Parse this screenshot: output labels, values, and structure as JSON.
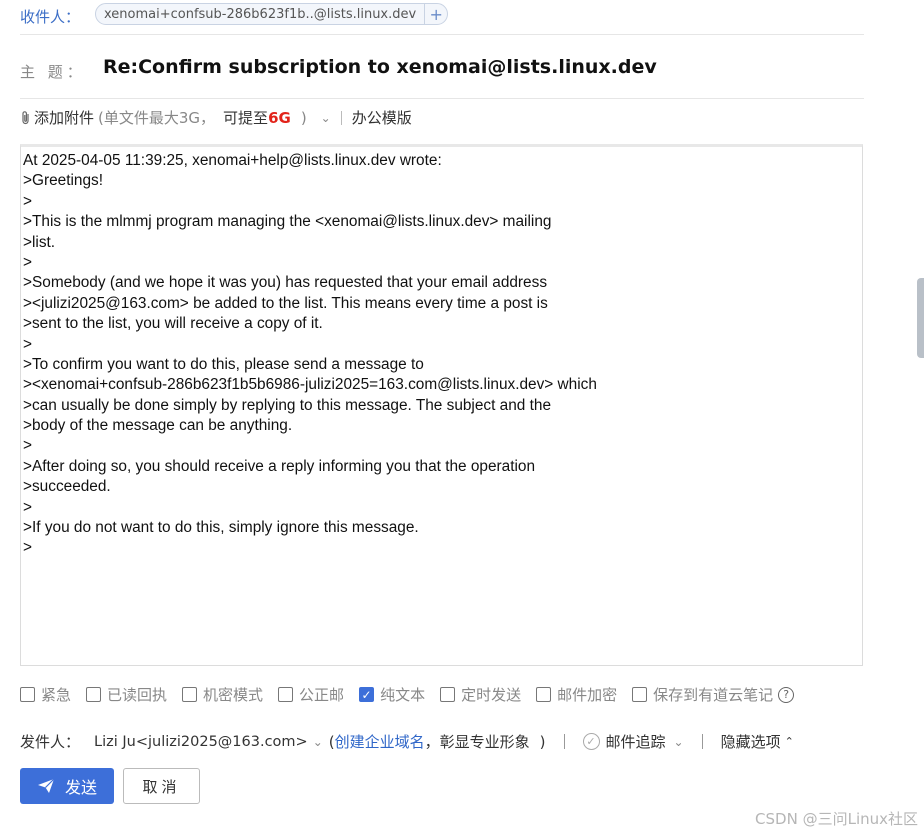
{
  "recipient": {
    "label": "收件人：",
    "address": "xenomai+confsub-286b623f1b..@lists.linux.dev",
    "add_icon": "plus-icon"
  },
  "subject": {
    "label": "主 题：",
    "value": "Re:Confirm subscription to xenomai@lists.linux.dev"
  },
  "attachment": {
    "icon": "paperclip-icon",
    "label": "添加附件",
    "limit_prefix": "(单文件最大3G，",
    "upgrade_text": "可提至",
    "upgrade_size": "6G",
    "limit_suffix": ")",
    "template_label": "办公模版"
  },
  "body_lines": [
    "At 2025-04-05 11:39:25, xenomai+help@lists.linux.dev wrote:",
    ">Greetings!",
    ">",
    ">This is the mlmmj program managing the <xenomai@lists.linux.dev> mailing",
    ">list.",
    ">",
    ">Somebody (and we hope it was you) has requested that your email address",
    "><julizi2025@163.com> be added to the list. This means every time a post is",
    ">sent to the list, you will receive a copy of it.",
    ">",
    ">To confirm you want to do this, please send a message to",
    "><xenomai+confsub-286b623f1b5b6986-julizi2025=163.com@lists.linux.dev> which",
    ">can usually be done simply by replying to this message. The subject and the",
    ">body of the message can be anything.",
    ">",
    ">After doing so, you should receive a reply informing you that the operation",
    ">succeeded.",
    ">",
    ">If you do not want to do this, simply ignore this message.",
    ">"
  ],
  "options": [
    {
      "label": "紧急",
      "checked": false
    },
    {
      "label": "已读回执",
      "checked": false
    },
    {
      "label": "机密模式",
      "checked": false
    },
    {
      "label": "公正邮",
      "checked": false
    },
    {
      "label": "纯文本",
      "checked": true
    },
    {
      "label": "定时发送",
      "checked": false
    },
    {
      "label": "邮件加密",
      "checked": false
    },
    {
      "label": "保存到有道云笔记",
      "checked": false
    }
  ],
  "sender": {
    "label": "发件人：",
    "value": "Lizi Ju<julizi2025@163.com>",
    "open_paren": "(",
    "link": "创建企业域名",
    "promo": "，彰显专业形象",
    "close_paren": ")",
    "tracking_label": "邮件追踪",
    "hide_label": "隐藏选项"
  },
  "buttons": {
    "send": "发送",
    "cancel": "取消"
  },
  "watermark": "CSDN @三问Linux社区",
  "colors": {
    "accent": "#3d6fd9",
    "link": "#2f66c8",
    "highlight": "#e2231a"
  }
}
